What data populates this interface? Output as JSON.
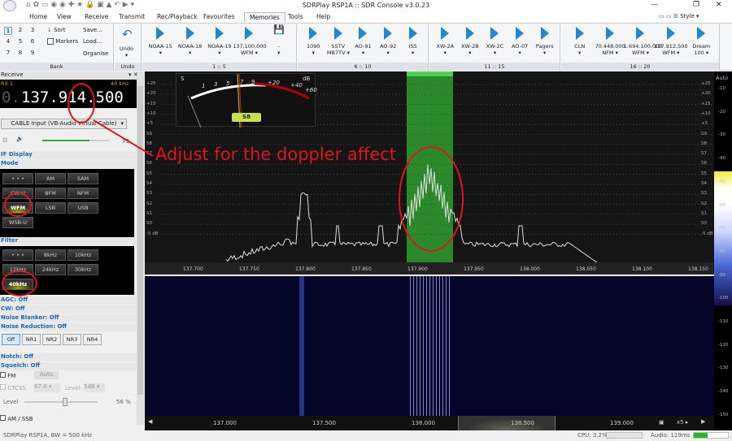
{
  "window": {
    "title": "SDRPlay RSP1A :: SDR Console v3.0.23",
    "minimize": "—",
    "restore": "❐",
    "close": "✕"
  },
  "tabs": [
    "Home",
    "View",
    "Receive",
    "Transmit",
    "Rec/Playback",
    "Favourites",
    "Memories",
    "Tools",
    "Help"
  ],
  "active_tab": "Memories",
  "style_label": "Style",
  "ribbon": {
    "bank": {
      "numbers": [
        "1",
        "2",
        "3",
        "4",
        "5",
        "6",
        "7",
        "8",
        "9"
      ],
      "sort": "Sort",
      "markers": "Markers",
      "save": "Save...",
      "load": "Load...",
      "organise": "Organise",
      "label": "Bank"
    },
    "undo": {
      "button": "Undo",
      "label": "Undo"
    },
    "groups": [
      {
        "label": "1 :: 5",
        "items": [
          {
            "l1": "NOAA-15",
            "l2": "▾"
          },
          {
            "l1": "NOAA-18",
            "l2": "▾"
          },
          {
            "l1": "NOAA-19",
            "l2": "▾"
          },
          {
            "l1": "137.100.000",
            "l2": "WFM ▾"
          },
          {
            "l1": "-",
            "l2": "▾"
          }
        ]
      },
      {
        "label": "6 :: 10",
        "items": [
          {
            "l1": "1090",
            "l2": "▾"
          },
          {
            "l1": "SSTV",
            "l2": "MB7TV ▾"
          },
          {
            "l1": "AO-91",
            "l2": "▾"
          },
          {
            "l1": "AO-92",
            "l2": "▾"
          },
          {
            "l1": "ISS",
            "l2": "▾"
          }
        ]
      },
      {
        "label": "11 :: 15",
        "items": [
          {
            "l1": "XW-2A",
            "l2": "▾"
          },
          {
            "l1": "XW-2B",
            "l2": "▾"
          },
          {
            "l1": "XW-2C",
            "l2": "▾"
          },
          {
            "l1": "AO-07",
            "l2": "▾"
          },
          {
            "l1": "Pagers",
            "l2": "▾"
          }
        ]
      },
      {
        "label": "16 :: 20",
        "items": [
          {
            "l1": "CLN",
            "l2": "▾"
          },
          {
            "l1": "70.448.000",
            "l2": "NFM ▾"
          },
          {
            "l1": "1.694.100.000",
            "l2": "WFM ▾"
          },
          {
            "l1": "137.912.500",
            "l2": "WFM ▾"
          },
          {
            "l1": "Dream",
            "l2": "100 ▾"
          }
        ]
      }
    ]
  },
  "receive": {
    "title": "Receive",
    "rx": "RX 1",
    "bw": "40 kHz",
    "freq_prefix": "0.",
    "frequency": "137.914.500",
    "input": "CABLE Input (VB-Audio Virtual Cable)",
    "volume": "79",
    "volume_fraction": 0.79,
    "if_display": "IF Display",
    "mode_label": "Mode",
    "modes": [
      "• • •",
      "AM",
      "SAM",
      "CW-U",
      "BFM",
      "NFM",
      "WFM",
      "LSB",
      "USB",
      "WSB-U"
    ],
    "active_mode": "WFM",
    "filter_label": "Filter",
    "filters": [
      "• • •",
      "8kHz",
      "10kHz",
      "12kHz",
      "24kHz",
      "30kHz",
      "40kHz"
    ],
    "active_filter": "40kHz",
    "agc": "AGC: Off",
    "cw": "CW: Off",
    "nb": "Noise Blanker: Off",
    "nr": "Noise Reduction: Off",
    "nr_buttons": [
      "Off",
      "NR1",
      "NR2",
      "NR3",
      "NR4"
    ],
    "notch": "Notch: Off",
    "squelch": "Squelch: Off",
    "fm": "FM",
    "auto": "Auto",
    "ctcss": "CTCSS",
    "ctcss_val": "67.0",
    "level_lbl": "Level:",
    "level_val": "5dB",
    "level": "Level",
    "level_pct": "56 %",
    "level_fraction": 0.56,
    "amssb": "AM / SSB"
  },
  "meter": {
    "s": "S",
    "scale": [
      "1",
      "3",
      "5",
      "7",
      "9",
      "+20",
      "+40",
      "+60"
    ],
    "db": "dB",
    "reading": "S8"
  },
  "spectrum": {
    "db_labels": [
      "+25",
      "+20",
      "+15",
      "+10",
      "+5",
      "S9",
      "S8",
      "S7",
      "S6",
      "S5",
      "S4",
      "S3",
      "S2",
      "S1",
      "S0",
      "-5 dB"
    ],
    "freq_labels": [
      "137.700",
      "137.750",
      "137.800",
      "137.850",
      "137.900",
      "137.950",
      "138.000",
      "138.050",
      "138.100",
      "138.150"
    ]
  },
  "annotation": "Adjust for the doppler affect",
  "right_scale": {
    "auto": "Auto",
    "labels": [
      "-10",
      "-20",
      "-30",
      "-40",
      "-50",
      "-60",
      "-70",
      "-80",
      "-90",
      "-100",
      "-110",
      "-120",
      "-130",
      "-140",
      "-150"
    ]
  },
  "overview": {
    "labels": [
      "137.000",
      "137.500",
      "138.000",
      "138.500",
      "139.000"
    ],
    "zoom": "x5"
  },
  "status": {
    "left": "SDRPlay RSP1A, BW = 500 kHz",
    "cpu": "CPU: 3.2%",
    "audio": "Audio: 119ms"
  }
}
